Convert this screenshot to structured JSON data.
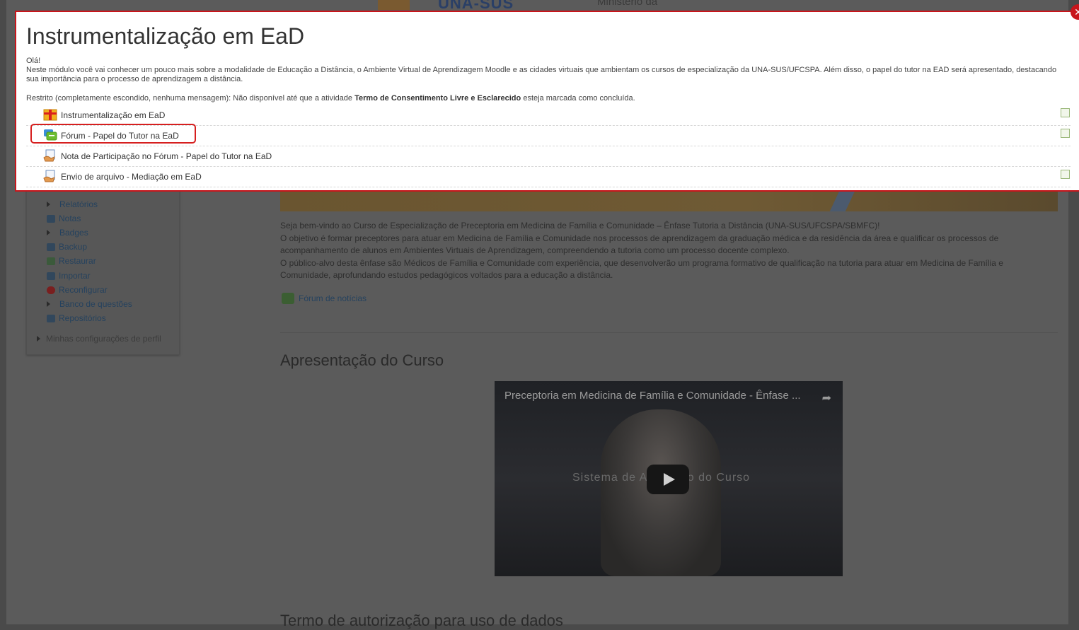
{
  "background": {
    "header": {
      "logo": "UNA-SUS",
      "ministry": "Ministério da"
    },
    "sidebar": {
      "items": [
        {
          "label": "Relatórios",
          "icon": "triangle-icon"
        },
        {
          "label": "Notas",
          "icon": "grades-icon"
        },
        {
          "label": "Badges",
          "icon": "triangle-icon"
        },
        {
          "label": "Backup",
          "icon": "backup-icon"
        },
        {
          "label": "Restaurar",
          "icon": "restore-icon"
        },
        {
          "label": "Importar",
          "icon": "import-icon"
        },
        {
          "label": "Reconfigurar",
          "icon": "reset-icon"
        },
        {
          "label": "Banco de questões",
          "icon": "triangle-icon"
        },
        {
          "label": "Repositórios",
          "icon": "repository-icon"
        }
      ],
      "profile_settings": "Minhas configurações de perfil"
    },
    "welcome_paragraphs": [
      "Seja bem-vindo ao Curso de Especialização de Preceptoria em Medicina de Família e Comunidade – Ênfase Tutoria a Distância (UNA-SUS/UFCSPA/SBMFC)!",
      "O objetivo é formar preceptores para atuar em Medicina de Família e Comunidade nos processos de aprendizagem da graduação médica e da residência da área e qualificar os processos de acompanhamento de alunos em Ambientes Virtuais de Aprendizagem, compreendendo a tutoria como um processo docente complexo.",
      "O público-alvo desta ênfase são Médicos de Família e Comunidade com experiência, que desenvolverão um programa formativo de qualificação na tutoria para atuar em Medicina de Família e Comunidade, aprofundando estudos pedagógicos voltados para a educação a distância."
    ],
    "news_forum": "Fórum de notícias",
    "section_title": "Apresentação do Curso",
    "video": {
      "title": "Preceptoria em Medicina de Família e Comunidade - Ênfase ...",
      "overlay_text": "Sistema de Avaliação do Curso"
    },
    "next_section_title": "Termo de autorização para uso de dados"
  },
  "modal": {
    "title": "Instrumentalização em EaD",
    "greeting": "Olá!",
    "description": "Neste módulo você vai conhecer um pouco mais sobre a modalidade de Educação a Distância, o Ambiente Virtual de Aprendizagem Moodle e as cidades virtuais que ambientam os cursos de especialização da UNA-SUS/UFCSPA. Além disso, o papel do tutor na EAD será apresentado, destacando sua importância para o processo de aprendizagem a distância.",
    "restriction_prefix": "Restrito (completamente escondido, nenhuma mensagem): Não disponível até que a atividade ",
    "restriction_activity": "Termo de Consentimento Livre e Esclarecido",
    "restriction_suffix": " esteja marcada como concluída.",
    "activities": [
      {
        "label": "Instrumentalização em EaD",
        "icon": "package-icon",
        "has_checkbox": true
      },
      {
        "label": "Fórum - Papel do Tutor na EaD",
        "icon": "forum-icon",
        "has_checkbox": true
      },
      {
        "label": "Nota de Participação no Fórum - Papel do Tutor na EaD",
        "icon": "assignment-icon",
        "has_checkbox": false
      },
      {
        "label": "Envio de arquivo - Mediação em EaD",
        "icon": "assignment-icon",
        "has_checkbox": true
      }
    ]
  }
}
